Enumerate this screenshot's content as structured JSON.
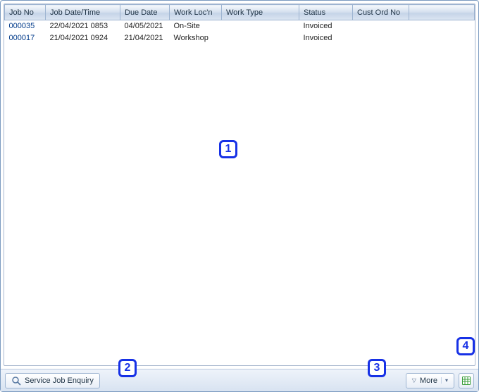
{
  "table": {
    "headers": {
      "jobno": "Job No",
      "datetime": "Job Date/Time",
      "due": "Due Date",
      "loc": "Work Loc'n",
      "type": "Work Type",
      "status": "Status",
      "cust": "Cust Ord No"
    },
    "rows": [
      {
        "jobno": "000035",
        "datetime": "22/04/2021 0853",
        "due": "04/05/2021",
        "loc": "On-Site",
        "type": "",
        "status": "Invoiced",
        "cust": ""
      },
      {
        "jobno": "000017",
        "datetime": "21/04/2021 0924",
        "due": "21/04/2021",
        "loc": "Workshop",
        "type": "",
        "status": "Invoiced",
        "cust": ""
      }
    ]
  },
  "toolbar": {
    "enquiry_label": "Service Job Enquiry",
    "more_label": "More"
  },
  "markers": {
    "m1": "1",
    "m2": "2",
    "m3": "3",
    "m4": "4"
  }
}
